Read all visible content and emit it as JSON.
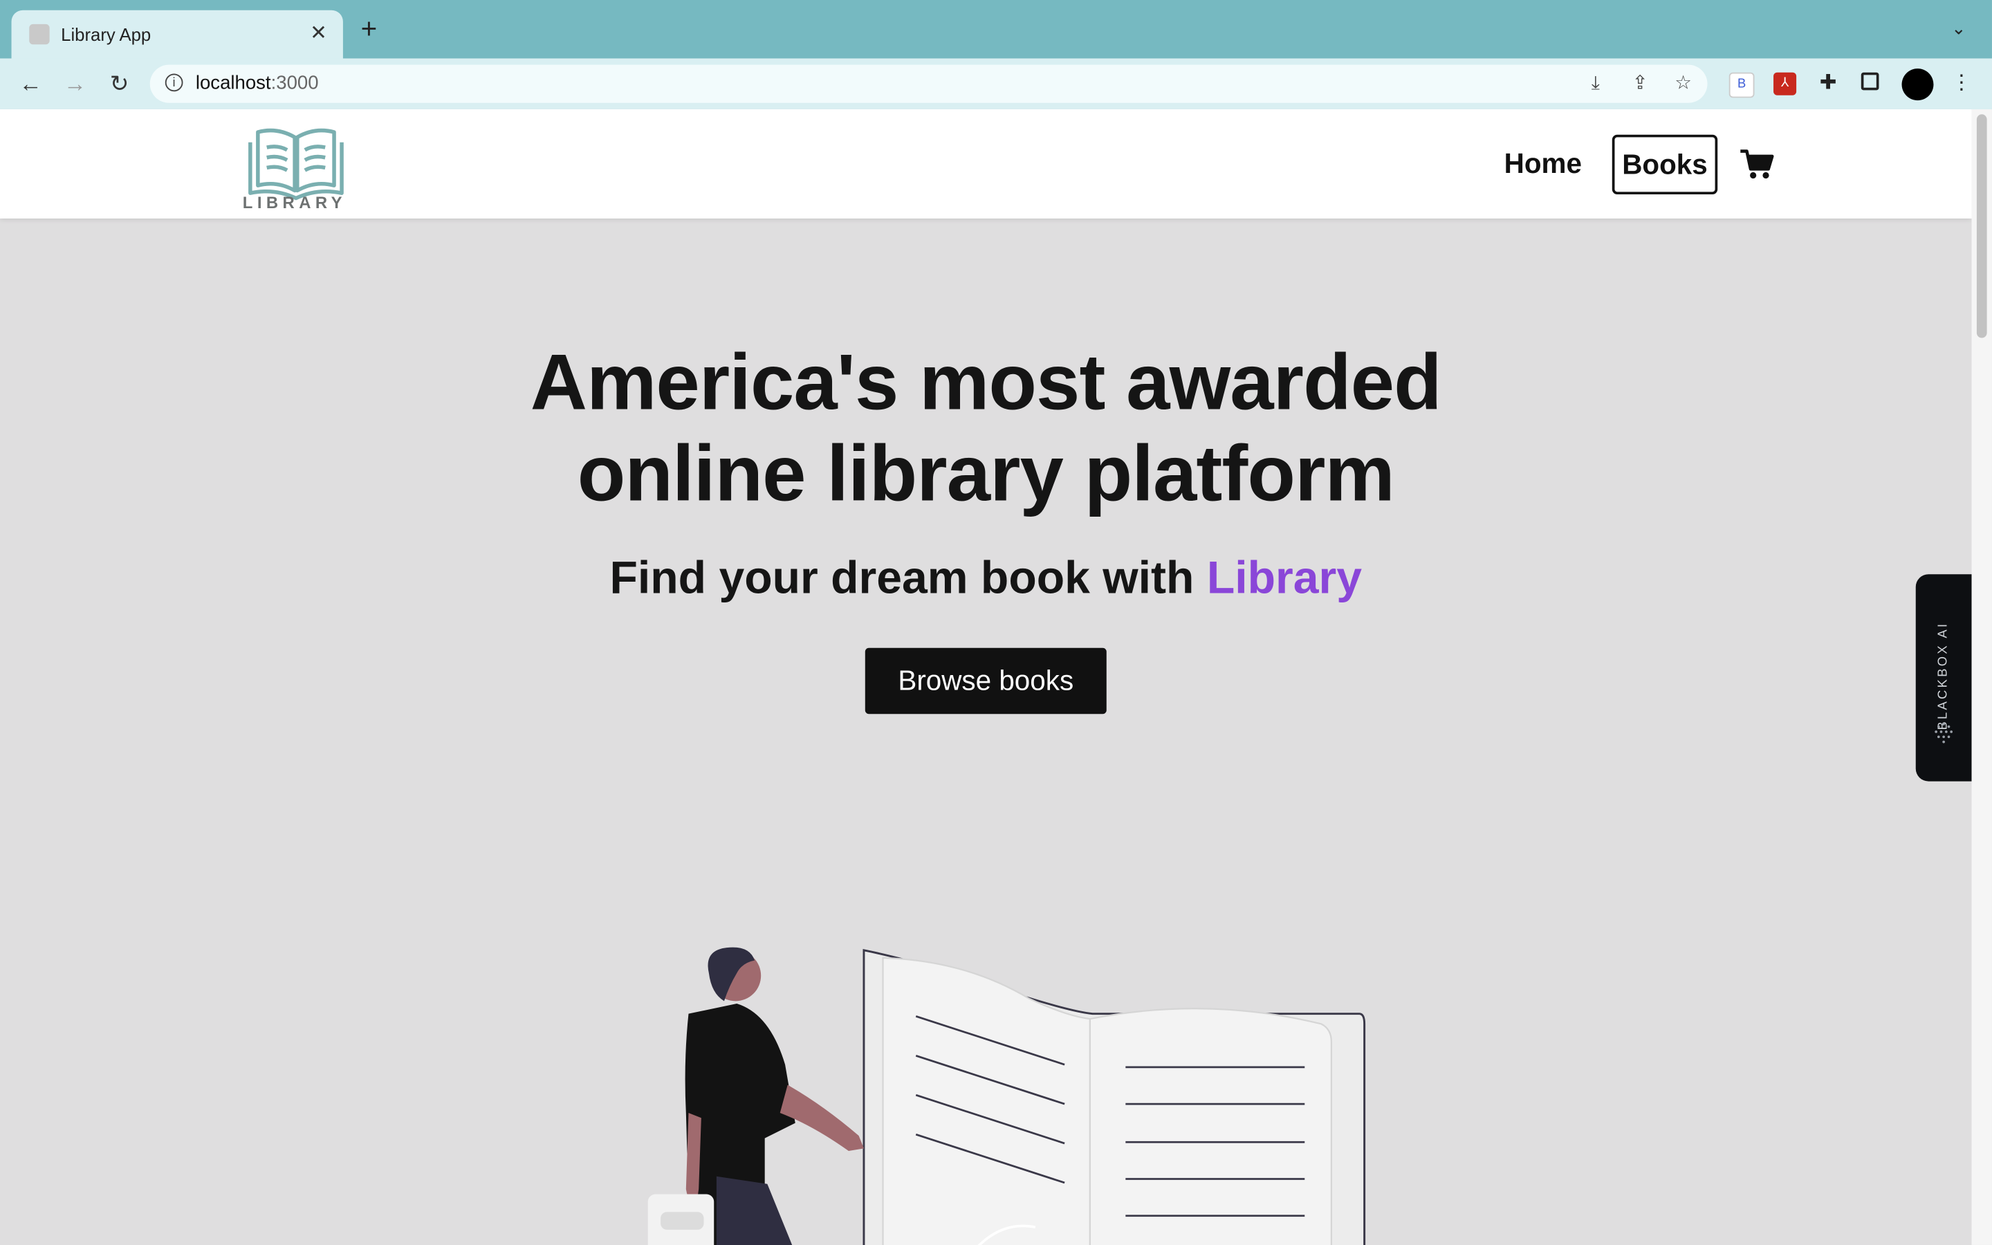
{
  "browser": {
    "tab_title": "Library App",
    "url_host": "localhost",
    "url_port": ":3000"
  },
  "site": {
    "logo_text": "LIBRARY",
    "nav": {
      "home": "Home",
      "books": "Books"
    }
  },
  "hero": {
    "headline_line1": "America's most awarded",
    "headline_line2": "online library platform",
    "subline_prefix": "Find your dream book with ",
    "subline_accent": "Library",
    "cta_label": "Browse books"
  },
  "widget": {
    "label": "BLACKBOX AI"
  },
  "colors": {
    "accent": "#8a46d8",
    "tabbar": "#76b9c1",
    "logo": "#7aafb0",
    "page_bg": "#dfdedf"
  }
}
